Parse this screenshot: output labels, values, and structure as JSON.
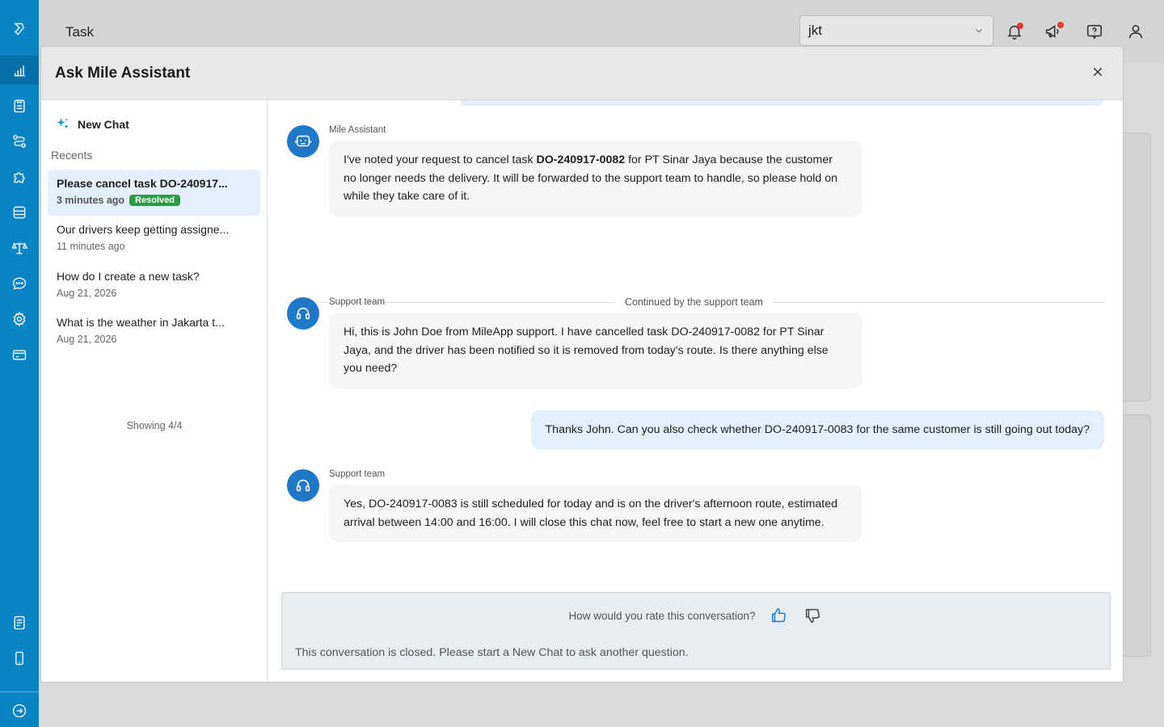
{
  "header": {
    "page_title": "Task",
    "hub_value": "jkt"
  },
  "modal": {
    "title": "Ask Mile Assistant",
    "new_chat_label": "New Chat",
    "recents_label": "Recents",
    "recents": [
      {
        "title": "Please cancel task DO-240917...",
        "time": "3 minutes ago",
        "badge": "Resolved"
      },
      {
        "title": "Our drivers keep getting assigne...",
        "time": "11 minutes ago"
      },
      {
        "title": "How do I create a new task?",
        "time": "Aug 21, 2026"
      },
      {
        "title": "What is the weather in Jakarta t...",
        "time": "Aug 21, 2026"
      }
    ],
    "showing_label": "Showing 4/4"
  },
  "chat": {
    "messages": [
      {
        "sender": "Mile Assistant",
        "text_before": "I've noted your request to cancel task ",
        "text_bold": "DO-240917-0082",
        "text_after": " for PT Sinar Jaya because the customer no longer needs the delivery. It will be forwarded to the support team to handle, so please hold on while they take care of it."
      },
      {
        "sender": "Support team",
        "text": "Hi, this is John Doe from MileApp support. I have cancelled task DO-240917-0082 for PT Sinar Jaya, and the driver has been notified so it is removed from today's route. Is there anything else you need?"
      },
      {
        "sender": "Support team",
        "text": "Yes, DO-240917-0083 is still scheduled for today and is on the driver's afternoon route, estimated arrival between 14:00 and 16:00. I will close this chat now, feel free to start a new one anytime."
      }
    ],
    "separator_label": "Continued by the support team",
    "user_message": "Thanks John. Can you also check whether DO-240917-0083 for the same customer is still going out today?",
    "rating_prompt": "How would you rate this conversation?",
    "closed_notice": "This conversation is closed. Please start a New Chat to ask another question."
  },
  "colors": {
    "sidebar": "#0a84c6",
    "accent": "#1f78c8",
    "resolved_badge": "#2e9b48",
    "user_bubble": "#e3f0fb",
    "notification_dot": "#e53935"
  },
  "icons": {
    "sidebar": [
      "logo-icon",
      "analytics-icon",
      "clipboard-icon",
      "route-icon",
      "puzzle-icon",
      "database-icon",
      "scale-icon",
      "chat-icon",
      "gear-icon",
      "card-icon",
      "document-icon",
      "mobile-icon",
      "logout-icon"
    ],
    "topbar": [
      "bell-icon",
      "megaphone-icon",
      "help-icon",
      "user-icon"
    ]
  }
}
